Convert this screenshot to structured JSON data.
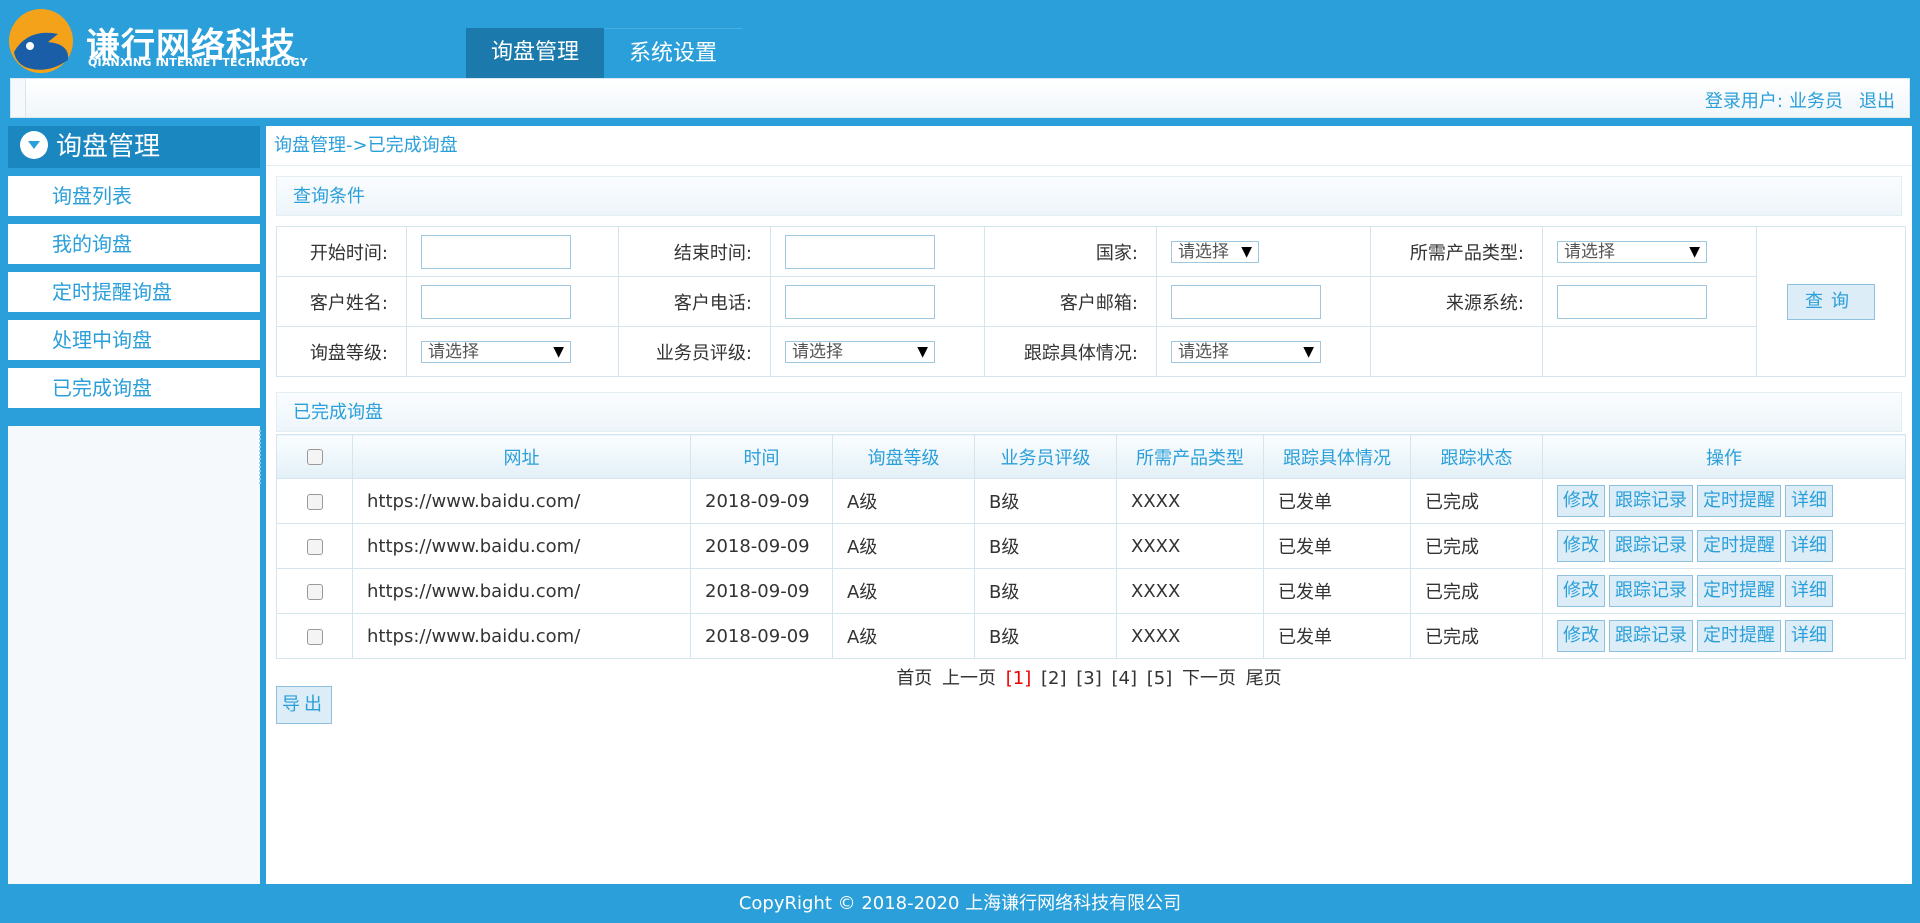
{
  "brand": {
    "name": "谦行网络科技",
    "subtitle": "QIANXING INTERNET TECHNOLOGY"
  },
  "topnav": {
    "tabs": [
      {
        "label": "询盘管理"
      },
      {
        "label": "系统设置"
      }
    ]
  },
  "userbar": {
    "login_label": "登录用户:",
    "user": "业务员",
    "logout": "退出"
  },
  "sidebar": {
    "title": "询盘管理",
    "items": [
      {
        "label": "询盘列表"
      },
      {
        "label": "我的询盘"
      },
      {
        "label": "定时提醒询盘"
      },
      {
        "label": "处理中询盘"
      },
      {
        "label": "已完成询盘"
      }
    ]
  },
  "breadcrumb": "询盘管理->已完成询盘",
  "query": {
    "title": "查询条件",
    "start_time": "开始时间:",
    "end_time": "结束时间:",
    "country": "国家:",
    "product_type": "所需产品类型:",
    "customer_name": "客户姓名:",
    "customer_phone": "客户电话:",
    "customer_email": "客户邮箱:",
    "source_system": "来源系统:",
    "inquiry_level": "询盘等级:",
    "sales_rating": "业务员评级:",
    "tracking_detail": "跟踪具体情况:",
    "select_placeholder": "请选择",
    "button": "查询"
  },
  "table": {
    "title": "已完成询盘",
    "columns": [
      "网址",
      "时间",
      "询盘等级",
      "业务员评级",
      "所需产品类型",
      "跟踪具体情况",
      "跟踪状态",
      "操作"
    ],
    "rows": [
      {
        "url": "https://www.baidu.com/",
        "date": "2018-09-09",
        "level": "A级",
        "rating": "B级",
        "product": "XXXX",
        "detail": "已发单",
        "status": "已完成"
      },
      {
        "url": "https://www.baidu.com/",
        "date": "2018-09-09",
        "level": "A级",
        "rating": "B级",
        "product": "XXXX",
        "detail": "已发单",
        "status": "已完成"
      },
      {
        "url": "https://www.baidu.com/",
        "date": "2018-09-09",
        "level": "A级",
        "rating": "B级",
        "product": "XXXX",
        "detail": "已发单",
        "status": "已完成"
      },
      {
        "url": "https://www.baidu.com/",
        "date": "2018-09-09",
        "level": "A级",
        "rating": "B级",
        "product": "XXXX",
        "detail": "已发单",
        "status": "已完成"
      }
    ],
    "actions": {
      "edit": "修改",
      "track": "跟踪记录",
      "remind": "定时提醒",
      "detail": "详细"
    }
  },
  "pager": {
    "first": "首页",
    "prev": "上一页",
    "pages": [
      "[1]",
      "[2]",
      "[3]",
      "[4]",
      "[5]"
    ],
    "next": "下一页",
    "last": "尾页"
  },
  "export_label": "导出",
  "footer": "CopyRight © 2018-2020 上海谦行网络科技有限公司",
  "colors": {
    "accent": "#2b9fd9",
    "active_tab": "#1b7aab",
    "current_page": "#ee0000"
  }
}
